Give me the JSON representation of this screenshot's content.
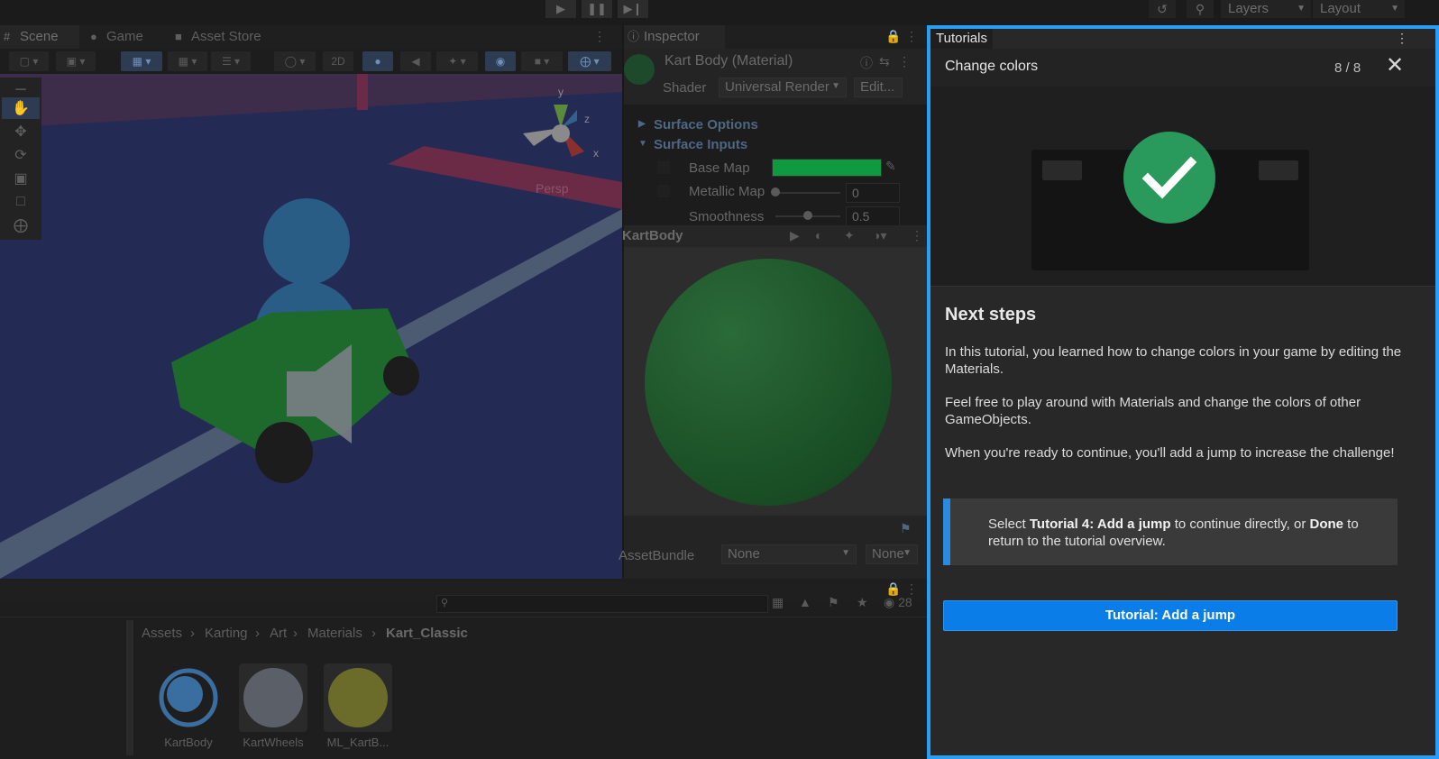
{
  "toolbar": {
    "layers_label": "Layers",
    "layout_label": "Layout"
  },
  "scene": {
    "tabs": [
      {
        "label": "Scene",
        "icon": "grid-icon"
      },
      {
        "label": "Game",
        "icon": "gamepad-icon"
      },
      {
        "label": "Asset Store",
        "icon": "bag-icon"
      }
    ],
    "twod_label": "2D",
    "persp_label": "Persp",
    "gizmo_axes": {
      "y": "y",
      "z": "z",
      "x": "x"
    }
  },
  "inspector": {
    "tab_label": "Inspector",
    "material_name": "Kart Body (Material)",
    "shader_label": "Shader",
    "shader_value": "Universal Render",
    "edit_label": "Edit...",
    "surface_options": "Surface Options",
    "surface_inputs": "Surface Inputs",
    "base_map_label": "Base Map",
    "base_map_color": "#0f9a3f",
    "metallic_map_label": "Metallic Map",
    "metallic_value": "0",
    "metallic_level": 0,
    "smoothness_label": "Smoothness",
    "smoothness_value": "0.5",
    "smoothness_level": 0.5,
    "preview_title": "KartBody",
    "assetbundle_label": "AssetBundle",
    "assetbundle_value": "None",
    "assetbundle_variant": "None"
  },
  "project": {
    "hidden_count": "28",
    "breadcrumb": [
      "Assets",
      "Karting",
      "Art",
      "Materials",
      "Kart_Classic"
    ],
    "assets": [
      {
        "name": "KartBody",
        "color": "#3a6ea0"
      },
      {
        "name": "KartWheels",
        "color": "#5b6068"
      },
      {
        "name": "ML_KartB...",
        "color": "#6b6c2a"
      }
    ]
  },
  "tutorial": {
    "tab_label": "Tutorials",
    "title": "Change colors",
    "page": "8 / 8",
    "heading": "Next steps",
    "paragraphs": [
      "In this tutorial, you learned how to change colors in your game by editing the Materials.",
      "Feel free to play around with Materials and change the colors of other GameObjects.",
      "When you're ready to continue, you'll add a jump to increase the challenge!"
    ],
    "callout": {
      "pre": "Select ",
      "bold1": "Tutorial 4: Add a jump",
      "mid": " to continue directly, or ",
      "bold2": "Done",
      "post": " to return to the tutorial overview."
    },
    "cta_label": "Tutorial: Add a jump",
    "accent": "#2a9df4",
    "success_color": "#2a9a5c"
  }
}
